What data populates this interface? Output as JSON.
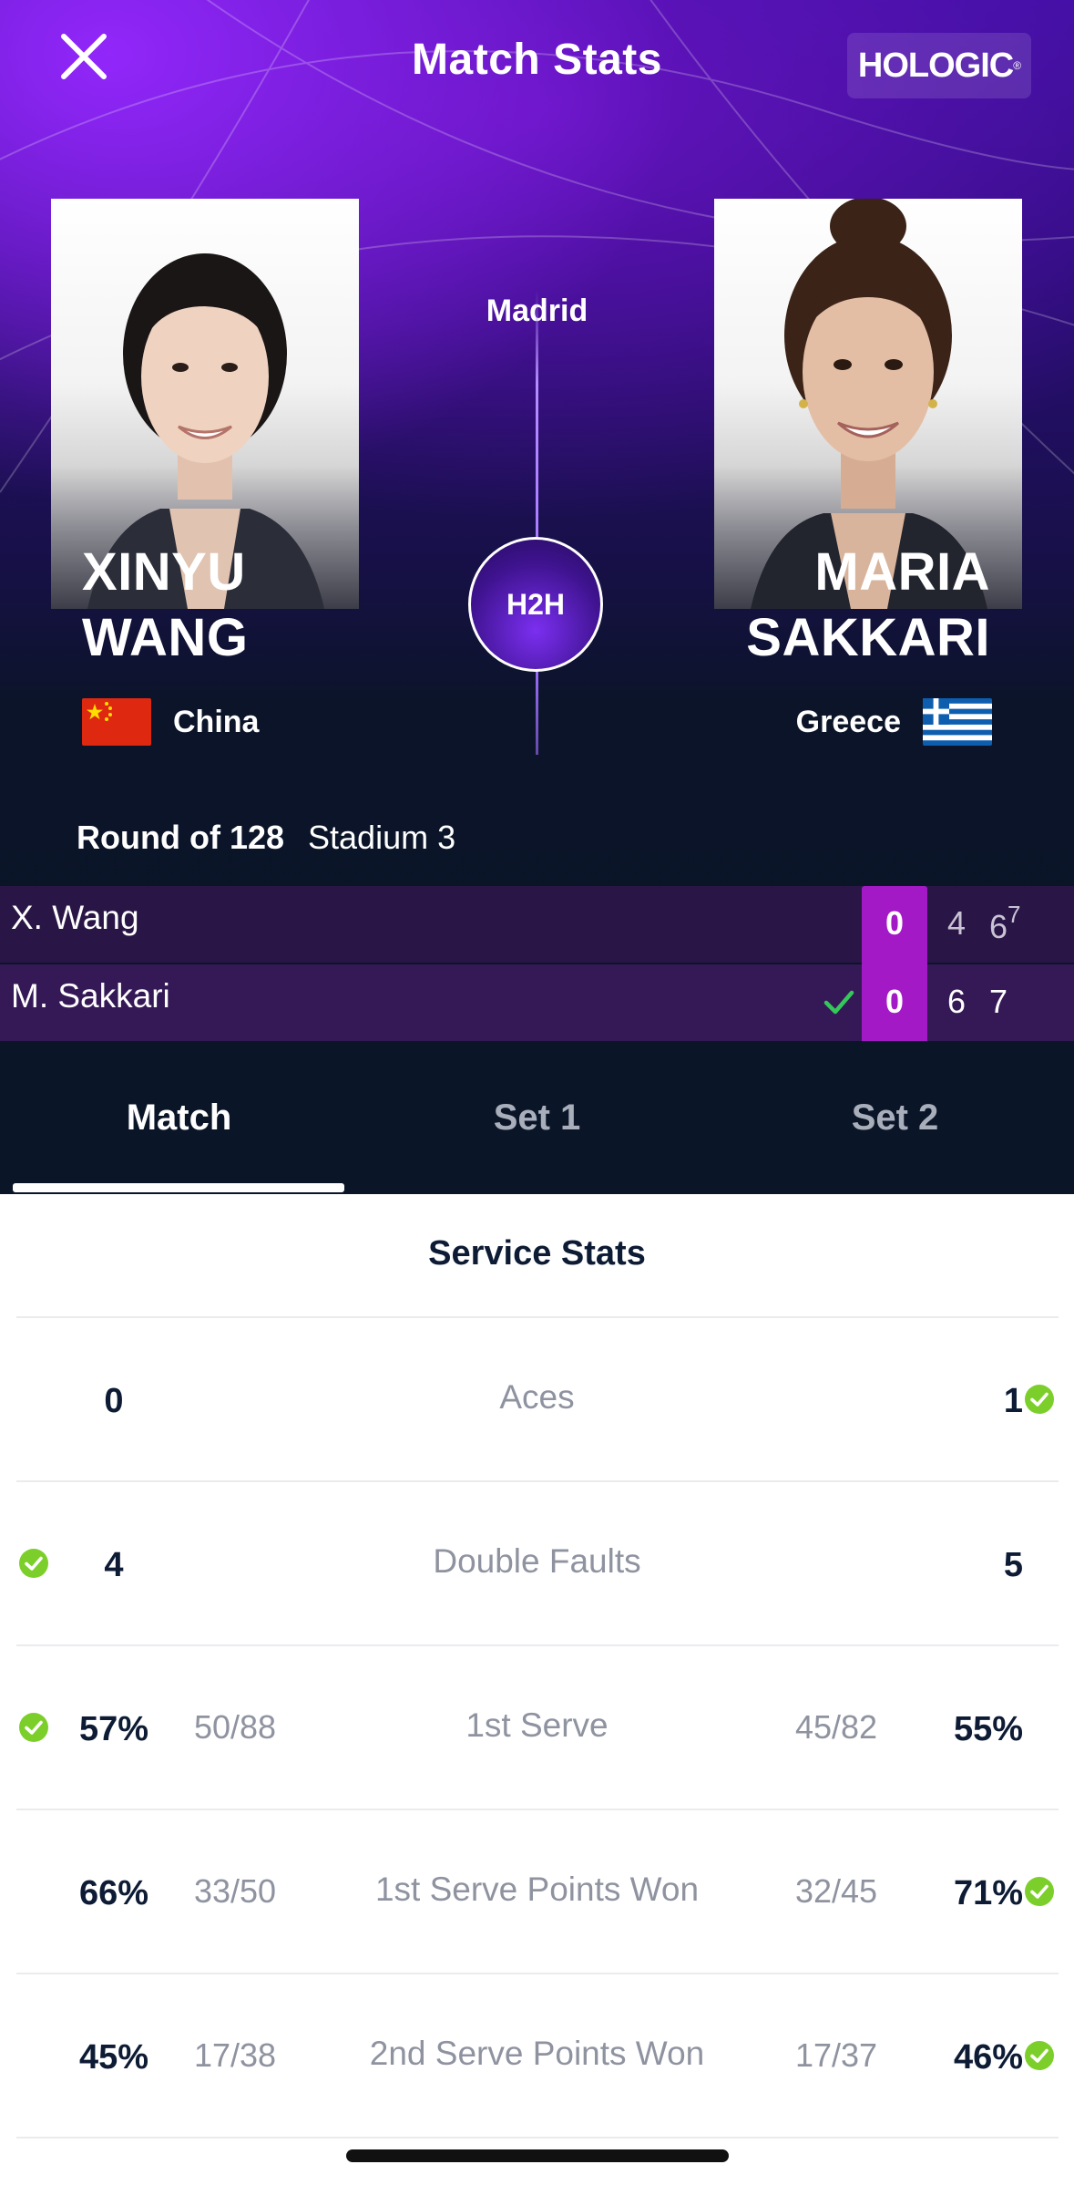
{
  "header": {
    "title": "Match Stats",
    "sponsor": "HOLOGIC",
    "close_icon": "close-icon"
  },
  "match": {
    "venue": "Madrid",
    "h2h_label": "H2H",
    "round": "Round of 128",
    "court": "Stadium 3"
  },
  "players": {
    "left": {
      "first": "XINYU",
      "last": "WANG",
      "country": "China",
      "flag": "china-flag"
    },
    "right": {
      "first": "MARIA",
      "last": "SAKKARI",
      "country": "Greece",
      "flag": "greece-flag"
    }
  },
  "score": {
    "rows": [
      {
        "name": "X. Wang",
        "current": "0",
        "sets": [
          "4",
          "6"
        ],
        "tiebreak": "7",
        "winner": false
      },
      {
        "name": "M. Sakkari",
        "current": "0",
        "sets": [
          "6",
          "7"
        ],
        "tiebreak": "",
        "winner": true
      }
    ],
    "current_color": "#a319c6",
    "check_color": "#34c759"
  },
  "tabs": [
    {
      "label": "Match",
      "active": true
    },
    {
      "label": "Set 1",
      "active": false
    },
    {
      "label": "Set 2",
      "active": false
    }
  ],
  "stats": {
    "section_title": "Service Stats",
    "rows": [
      {
        "label": "Aces",
        "left": "0",
        "right": "1",
        "left_frac": "",
        "right_frac": "",
        "leader": "right"
      },
      {
        "label": "Double Faults",
        "left": "4",
        "right": "5",
        "left_frac": "",
        "right_frac": "",
        "leader": "left"
      },
      {
        "label": "1st Serve",
        "left": "57%",
        "right": "55%",
        "left_frac": "50/88",
        "right_frac": "45/82",
        "leader": "left"
      },
      {
        "label": "1st Serve Points Won",
        "left": "66%",
        "right": "71%",
        "left_frac": "33/50",
        "right_frac": "32/45",
        "leader": "right"
      },
      {
        "label": "2nd Serve Points Won",
        "left": "45%",
        "right": "46%",
        "left_frac": "17/38",
        "right_frac": "17/37",
        "leader": "right"
      }
    ],
    "leader_icon_color": "#7ccf2a"
  }
}
